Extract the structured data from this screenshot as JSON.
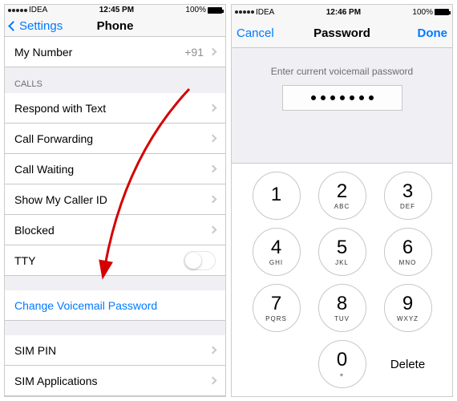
{
  "left": {
    "status": {
      "carrier": "IDEA",
      "time": "12:45 PM",
      "battery": "100%"
    },
    "nav": {
      "back": "Settings",
      "title": "Phone"
    },
    "my_number": {
      "label": "My Number",
      "value": "+91"
    },
    "calls_header": "CALLS",
    "rows": {
      "respond": "Respond with Text",
      "forwarding": "Call Forwarding",
      "waiting": "Call Waiting",
      "callerid": "Show My Caller ID",
      "blocked": "Blocked",
      "tty": "TTY",
      "change_vm": "Change Voicemail Password",
      "sim_pin": "SIM PIN",
      "sim_apps": "SIM Applications"
    }
  },
  "right": {
    "status": {
      "carrier": "IDEA",
      "time": "12:46 PM",
      "battery": "100%"
    },
    "nav": {
      "cancel": "Cancel",
      "title": "Password",
      "done": "Done"
    },
    "prompt": "Enter current voicemail password",
    "password_len": 7,
    "keypad": [
      {
        "n": "1",
        "s": ""
      },
      {
        "n": "2",
        "s": "ABC"
      },
      {
        "n": "3",
        "s": "DEF"
      },
      {
        "n": "4",
        "s": "GHI"
      },
      {
        "n": "5",
        "s": "JKL"
      },
      {
        "n": "6",
        "s": "MNO"
      },
      {
        "n": "7",
        "s": "PQRS"
      },
      {
        "n": "8",
        "s": "TUV"
      },
      {
        "n": "9",
        "s": "WXYZ"
      },
      {
        "n": "0",
        "s": "+"
      }
    ],
    "delete": "Delete"
  }
}
